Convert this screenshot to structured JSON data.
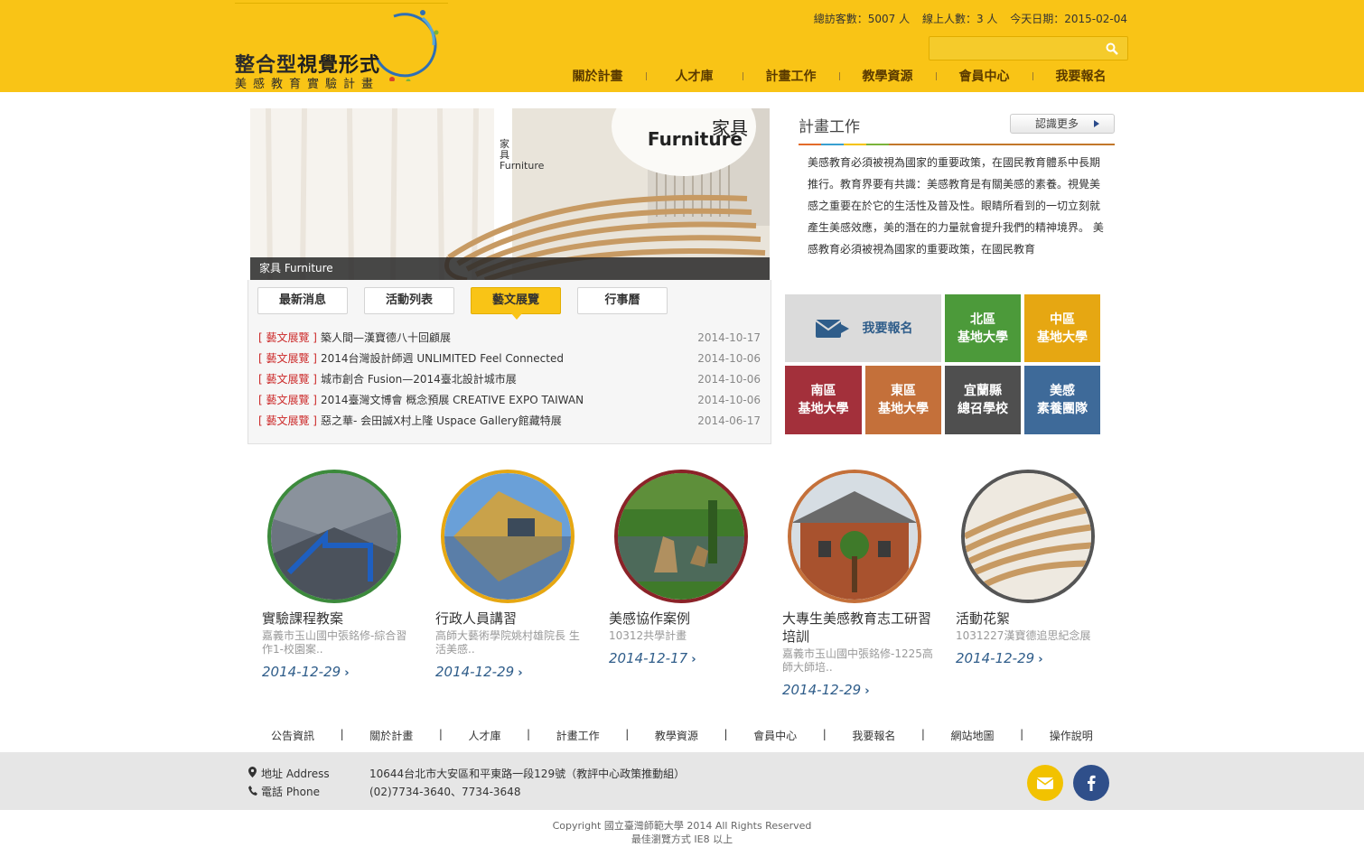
{
  "stats": {
    "visitors": "總訪客數：5007 人",
    "online": "線上人數：3 人",
    "today": "今天日期：2015-02-04"
  },
  "logo": {
    "title_a": "整合型",
    "title_b": "視覺形式",
    "subtitle": "美感教育實驗計畫"
  },
  "search": {
    "placeholder": ""
  },
  "nav": [
    "關於計畫",
    "人才庫",
    "計畫工作",
    "教學資源",
    "會員中心",
    "我要報名"
  ],
  "slider": {
    "caption": "家具 Furniture",
    "title_cn": "家具",
    "title_en": "Furniture",
    "vertical_text": "家具 Furniture"
  },
  "tabs": [
    "最新消息",
    "活動列表",
    "藝文展覽",
    "行事曆"
  ],
  "news": [
    {
      "tag": "[ 藝文展覽 ]",
      "title": "築人間—漢寶德八十回顧展",
      "date": "2014-10-17"
    },
    {
      "tag": "[ 藝文展覽 ]",
      "title": "2014台灣設計師週 UNLIMITED Feel Connected",
      "date": "2014-10-06"
    },
    {
      "tag": "[ 藝文展覽 ]",
      "title": "城市創合 Fusion—2014臺北設計城市展",
      "date": "2014-10-06"
    },
    {
      "tag": "[ 藝文展覽 ]",
      "title": "2014臺灣文博會 概念預展 CREATIVE EXPO TAIWAN",
      "date": "2014-10-06"
    },
    {
      "tag": "[ 藝文展覽 ]",
      "title": "惡之華- 会田誠X村上隆 Uspace Gallery館藏特展",
      "date": "2014-06-17"
    }
  ],
  "plan": {
    "title": "計畫工作",
    "more": "認識更多",
    "text": "美感教育必須被視為國家的重要政策，在國民教育體系中長期推行。教育界要有共識：美感教育是有關美感的素養。視覺美感之重要在於它的生活性及普及性。眼睛所看到的一切立刻就產生美感效應，美的潛在的力量就會提升我們的精神境界。 美感教育必須被視為國家的重要政策，在國民教育"
  },
  "tiles": {
    "signup": "我要報名",
    "north": [
      "北區",
      "基地大學"
    ],
    "central": [
      "中區",
      "基地大學"
    ],
    "south": [
      "南區",
      "基地大學"
    ],
    "east": [
      "東區",
      "基地大學"
    ],
    "yilan": [
      "宜蘭縣",
      "總召學校"
    ],
    "team": [
      "美感",
      "素養團隊"
    ]
  },
  "colors": {
    "brand_yellow": "#f9c416",
    "tile_north": "#4c9a3a",
    "tile_central": "#e6a712",
    "tile_south": "#a3303b",
    "tile_east": "#c4703a",
    "tile_yilan": "#4f4f4f",
    "tile_team": "#3e6a99"
  },
  "cards": [
    {
      "title": "實驗課程教案",
      "desc": "嘉義市玉山國中張銘修-綜合習作1-校園案..",
      "date": "2014-12-29"
    },
    {
      "title": "行政人員講習",
      "desc": "高師大藝術學院姚村雄院長 生活美感..",
      "date": "2014-12-29"
    },
    {
      "title": "美感協作案例",
      "desc": "10312共學計畫",
      "date": "2014-12-17"
    },
    {
      "title": "大專生美感教育志工研習培訓",
      "desc": "嘉義市玉山國中張銘修-1225高師大師培..",
      "date": "2014-12-29"
    },
    {
      "title": "活動花絮",
      "desc": "1031227漢寶德追思紀念展",
      "date": "2014-12-29"
    }
  ],
  "footer_links": [
    "公告資訊",
    "關於計畫",
    "人才庫",
    "計畫工作",
    "教學資源",
    "會員中心",
    "我要報名",
    "網站地圖",
    "操作說明"
  ],
  "footer": {
    "address_label": "地址 Address",
    "address": "10644台北市大安區和平東路一段129號（教評中心政策推動組）",
    "phone_label": "電話 Phone",
    "phone": "(02)7734-3640、7734-3648",
    "copyright": "Copyright 國立臺灣師範大學 2014 All Rights Reserved",
    "browser": "最佳瀏覽方式 IE8 以上"
  }
}
